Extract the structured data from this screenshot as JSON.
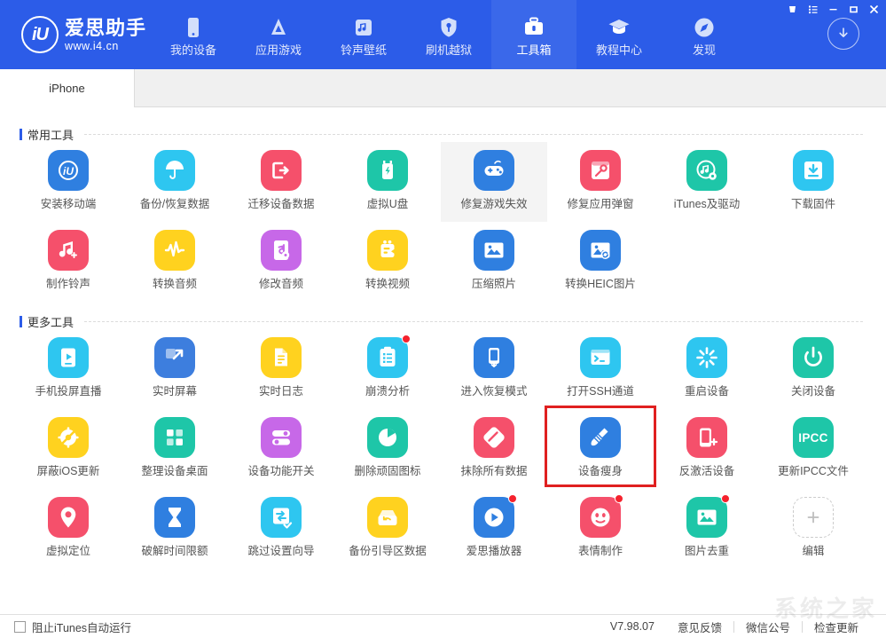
{
  "app": {
    "logo_name": "爱思助手",
    "logo_url": "www.i4.cn",
    "logo_mark": "iU",
    "watermark": "系统之家"
  },
  "window_controls": [
    {
      "name": "skin-icon",
      "label": "皮肤"
    },
    {
      "name": "menu-icon",
      "label": "菜单"
    },
    {
      "name": "minimize-icon",
      "label": "最小化"
    },
    {
      "name": "maximize-icon",
      "label": "最大化"
    },
    {
      "name": "close-icon",
      "label": "关闭"
    }
  ],
  "nav": {
    "items": [
      {
        "label": "我的设备",
        "icon": "phone-icon",
        "active": false
      },
      {
        "label": "应用游戏",
        "icon": "appstore-icon",
        "active": false
      },
      {
        "label": "铃声壁纸",
        "icon": "music-note-icon",
        "active": false
      },
      {
        "label": "刷机越狱",
        "icon": "shield-key-icon",
        "active": false
      },
      {
        "label": "工具箱",
        "icon": "toolbox-icon",
        "active": true
      },
      {
        "label": "教程中心",
        "icon": "graduation-cap-icon",
        "active": false
      },
      {
        "label": "发现",
        "icon": "compass-icon",
        "active": false
      }
    ],
    "download_button": "download-icon"
  },
  "tabs": [
    {
      "label": "iPhone",
      "active": true
    }
  ],
  "sections": [
    {
      "title": "常用工具",
      "tools": [
        {
          "label": "安装移动端",
          "icon": "i4-logo-icon",
          "bg": "#2f7fe0",
          "badge": false,
          "hovered": false
        },
        {
          "label": "备份/恢复数据",
          "icon": "umbrella-icon",
          "bg": "#2ec6f0",
          "badge": false,
          "hovered": false
        },
        {
          "label": "迁移设备数据",
          "icon": "transfer-out-icon",
          "bg": "#f5506b",
          "badge": false,
          "hovered": false
        },
        {
          "label": "虚拟U盘",
          "icon": "usb-flash-icon",
          "bg": "#1ec6a8",
          "badge": false,
          "hovered": false
        },
        {
          "label": "修复游戏失效",
          "icon": "gamepad-icon",
          "bg": "#2f7fe0",
          "badge": false,
          "hovered": true
        },
        {
          "label": "修复应用弹窗",
          "icon": "window-wrench-icon",
          "bg": "#f5506b",
          "badge": false,
          "hovered": false
        },
        {
          "label": "iTunes及驱动",
          "icon": "itunes-gear-icon",
          "bg": "#1ec6a8",
          "badge": false,
          "hovered": false
        },
        {
          "label": "下载固件",
          "icon": "download-box-icon",
          "bg": "#2ec6f0",
          "badge": false,
          "hovered": false
        },
        {
          "label": "制作铃声",
          "icon": "ringtone-plus-icon",
          "bg": "#f5506b",
          "badge": false,
          "hovered": false
        },
        {
          "label": "转换音频",
          "icon": "waveform-icon",
          "bg": "#ffd21f",
          "badge": false,
          "hovered": false
        },
        {
          "label": "修改音频",
          "icon": "audio-edit-icon",
          "bg": "#c768e8",
          "badge": false,
          "hovered": false
        },
        {
          "label": "转换视频",
          "icon": "video-convert-icon",
          "bg": "#ffd21f",
          "badge": false,
          "hovered": false
        },
        {
          "label": "压缩照片",
          "icon": "photo-icon",
          "bg": "#2f7fe0",
          "badge": false,
          "hovered": false
        },
        {
          "label": "转换HEIC图片",
          "icon": "photo-refresh-icon",
          "bg": "#2f7fe0",
          "badge": false,
          "hovered": false
        }
      ]
    },
    {
      "title": "更多工具",
      "tools": [
        {
          "label": "手机投屏直播",
          "icon": "screencast-play-icon",
          "bg": "#2ec6f0",
          "badge": false,
          "hovered": false
        },
        {
          "label": "实时屏幕",
          "icon": "screen-expand-icon",
          "bg": "#3d7ede",
          "badge": false,
          "hovered": false
        },
        {
          "label": "实时日志",
          "icon": "document-lines-icon",
          "bg": "#ffd21f",
          "badge": false,
          "hovered": false
        },
        {
          "label": "崩溃分析",
          "icon": "clipboard-list-icon",
          "bg": "#2ec6f0",
          "badge": true,
          "hovered": false
        },
        {
          "label": "进入恢复模式",
          "icon": "phone-restore-icon",
          "bg": "#2f7fe0",
          "badge": false,
          "hovered": false
        },
        {
          "label": "打开SSH通道",
          "icon": "terminal-icon",
          "bg": "#2ec6f0",
          "badge": false,
          "hovered": false
        },
        {
          "label": "重启设备",
          "icon": "restart-burst-icon",
          "bg": "#2ec6f0",
          "badge": false,
          "hovered": false
        },
        {
          "label": "关闭设备",
          "icon": "power-icon",
          "bg": "#1ec6a8",
          "badge": false,
          "hovered": false
        },
        {
          "label": "屏蔽iOS更新",
          "icon": "gear-block-icon",
          "bg": "#ffd21f",
          "badge": false,
          "hovered": false
        },
        {
          "label": "整理设备桌面",
          "icon": "grid-squares-icon",
          "bg": "#1ec6a8",
          "badge": false,
          "hovered": false
        },
        {
          "label": "设备功能开关",
          "icon": "toggles-icon",
          "bg": "#c768e8",
          "badge": false,
          "hovered": false
        },
        {
          "label": "删除顽固图标",
          "icon": "pie-clock-icon",
          "bg": "#1ec6a8",
          "badge": false,
          "hovered": false
        },
        {
          "label": "抹除所有数据",
          "icon": "eraser-icon",
          "bg": "#f5506b",
          "badge": false,
          "hovered": false
        },
        {
          "label": "设备瘦身",
          "icon": "broom-clean-icon",
          "bg": "#2f7fe0",
          "badge": false,
          "hovered": false
        },
        {
          "label": "反激活设备",
          "icon": "phone-plus-icon",
          "bg": "#f5506b",
          "badge": false,
          "hovered": false
        },
        {
          "label": "更新IPCC文件",
          "icon": "ipcc-text-icon",
          "bg": "#1ec6a8",
          "badge": false,
          "hovered": false
        },
        {
          "label": "虚拟定位",
          "icon": "location-pin-icon",
          "bg": "#f5506b",
          "badge": false,
          "hovered": false
        },
        {
          "label": "破解时间限额",
          "icon": "hourglass-icon",
          "bg": "#2f7fe0",
          "badge": false,
          "hovered": false
        },
        {
          "label": "跳过设置向导",
          "icon": "skip-setup-icon",
          "bg": "#2ec6f0",
          "badge": false,
          "hovered": false
        },
        {
          "label": "备份引导区数据",
          "icon": "backup-boot-icon",
          "bg": "#ffd21f",
          "badge": false,
          "hovered": false
        },
        {
          "label": "爱思播放器",
          "icon": "play-circle-icon",
          "bg": "#2f7fe0",
          "badge": true,
          "hovered": false
        },
        {
          "label": "表情制作",
          "icon": "emoji-icon",
          "bg": "#f5506b",
          "badge": true,
          "hovered": false
        },
        {
          "label": "图片去重",
          "icon": "photo-dedupe-icon",
          "bg": "#1ec6a8",
          "badge": true,
          "hovered": false
        },
        {
          "label": "编辑",
          "icon": "plus-icon",
          "bg": "ghost",
          "badge": false,
          "hovered": false
        }
      ]
    }
  ],
  "annotation": {
    "target_label": "设备瘦身",
    "color": "#e02020"
  },
  "statusbar": {
    "checkbox_label": "阻止iTunes自动运行",
    "checkbox_checked": false,
    "version": "V7.98.07",
    "feedback": "意见反馈",
    "wechat": "微信公号",
    "check_update": "检查更新"
  }
}
